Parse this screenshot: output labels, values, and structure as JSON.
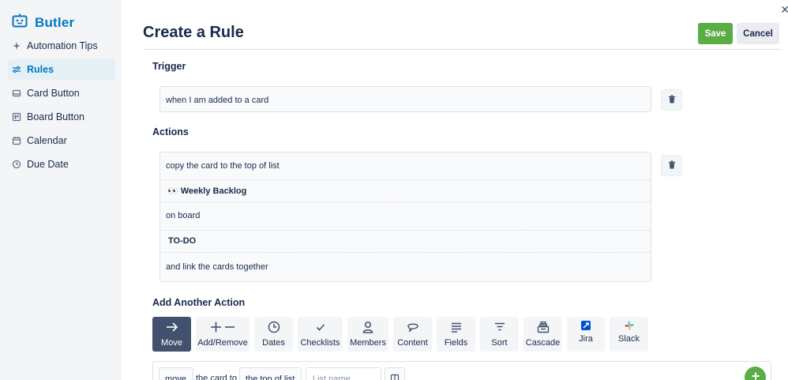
{
  "app": {
    "title": "Butler"
  },
  "sidebar": {
    "items": [
      {
        "label": "Automation Tips",
        "icon": "sparkle-icon",
        "active": false
      },
      {
        "label": "Rules",
        "icon": "sliders-icon",
        "active": true
      },
      {
        "label": "Card Button",
        "icon": "card-icon",
        "active": false
      },
      {
        "label": "Board Button",
        "icon": "board-icon",
        "active": false
      },
      {
        "label": "Calendar",
        "icon": "calendar-icon",
        "active": false
      },
      {
        "label": "Due Date",
        "icon": "clock-icon",
        "active": false
      }
    ]
  },
  "header": {
    "title": "Create a Rule",
    "save_label": "Save",
    "cancel_label": "Cancel"
  },
  "trigger": {
    "heading": "Trigger",
    "text": "when I am added to a card"
  },
  "actions": {
    "heading": "Actions",
    "rows": [
      {
        "text": "copy the card to the top of list",
        "bold": false
      },
      {
        "text": "👀 Weekly Backlog",
        "bold": true
      },
      {
        "text": "on board",
        "bold": false
      },
      {
        "text": "TO-DO",
        "bold": true
      },
      {
        "text": "and link the cards together",
        "bold": false
      }
    ]
  },
  "add_action": {
    "heading": "Add Another Action",
    "tiles": [
      {
        "label": "Move",
        "icon": "arrow-right-icon",
        "active": true
      },
      {
        "label": "Add/Remove",
        "icon": "plus-minus-icon",
        "active": false
      },
      {
        "label": "Dates",
        "icon": "clock-icon",
        "active": false
      },
      {
        "label": "Checklists",
        "icon": "check-icon",
        "active": false
      },
      {
        "label": "Members",
        "icon": "person-icon",
        "active": false
      },
      {
        "label": "Content",
        "icon": "speech-bubble-icon",
        "active": false
      },
      {
        "label": "Fields",
        "icon": "lines-icon",
        "active": false
      },
      {
        "label": "Sort",
        "icon": "sort-icon",
        "active": false
      },
      {
        "label": "Cascade",
        "icon": "cascade-icon",
        "active": false
      },
      {
        "label": "Jira",
        "icon": "jira-icon",
        "active": false
      },
      {
        "label": "Slack",
        "icon": "slack-icon",
        "active": false
      }
    ]
  },
  "builder": {
    "verb": "move",
    "text1": "the card to",
    "position": "the top of list",
    "list_placeholder": "List name"
  },
  "colors": {
    "brand": "#0079bf",
    "save": "#5aac44",
    "active_tile": "#42526e"
  }
}
